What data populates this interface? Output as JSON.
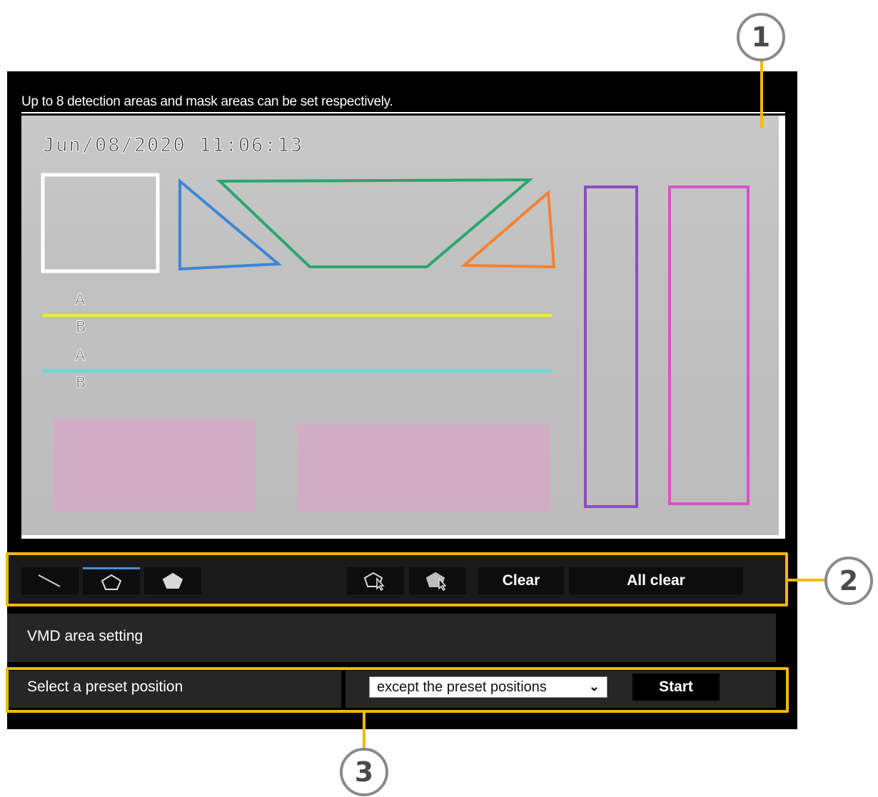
{
  "header": {
    "notice": "Up to 8 detection areas and mask areas can be set respectively."
  },
  "camera_view": {
    "timestamp": "Jun/08/2020 11:06:13",
    "line_labels": {
      "yellow_a": "A",
      "yellow_b": "B",
      "cyan_a": "A",
      "cyan_b": "B"
    },
    "area_colors": {
      "white": "#ffffff",
      "blue": "#3c86d6",
      "green": "#2aa86a",
      "orange": "#f58230",
      "purple": "#8a4fc0",
      "magenta": "#d455c8",
      "yellow_line": "#f0ea3c",
      "cyan_line": "#6cd8d8",
      "mask_fill": "#d8a8c8"
    }
  },
  "toolbar": {
    "tools": [
      {
        "icon": "line-draw-icon",
        "active": false
      },
      {
        "icon": "polygon-outline-icon",
        "active": true
      },
      {
        "icon": "polygon-filled-icon",
        "active": false
      },
      {
        "icon": "polygon-select-outline-icon",
        "active": false
      },
      {
        "icon": "polygon-select-filled-icon",
        "active": false
      }
    ],
    "clear_label": "Clear",
    "all_clear_label": "All clear"
  },
  "vmd": {
    "title": "VMD area setting"
  },
  "preset": {
    "label": "Select a preset position",
    "selected_option": "except the preset positions",
    "start_label": "Start"
  },
  "callouts": {
    "c1": "1",
    "c2": "2",
    "c3": "3",
    "color": "#f5b70a"
  }
}
